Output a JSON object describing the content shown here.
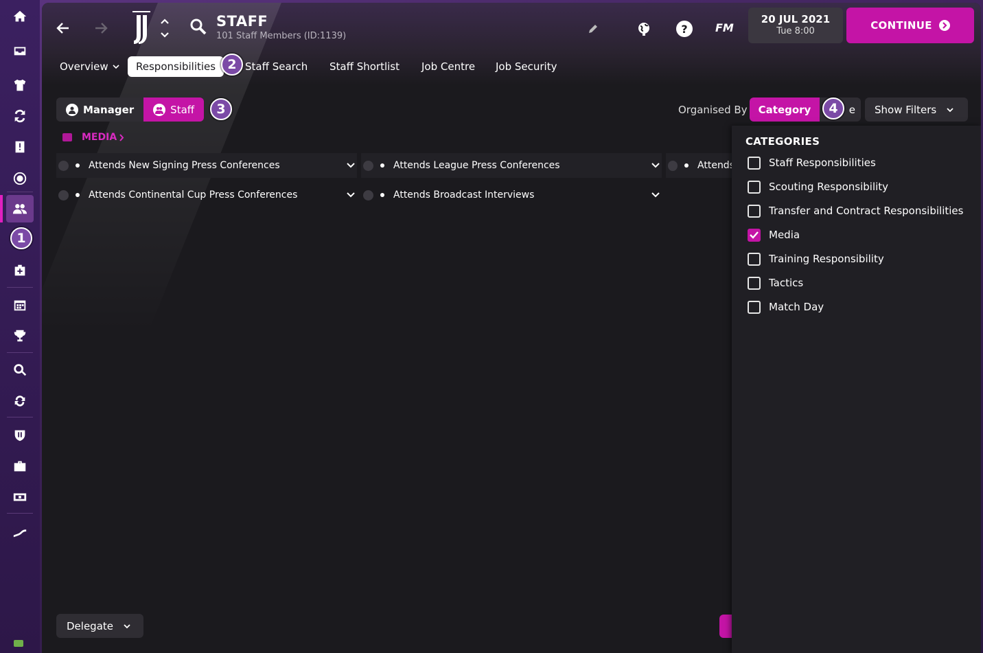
{
  "header": {
    "title": "STAFF",
    "subtitle": "101 Staff Members (ID:1139)",
    "fm_logo": "FM",
    "date": "20 JUL 2021",
    "day_time": "Tue 8:00",
    "continue_label": "CONTINUE"
  },
  "tabs": {
    "overview": "Overview",
    "responsibilities": "Responsibilities",
    "staff_search": "Staff Search",
    "staff_shortlist": "Staff Shortlist",
    "job_centre": "Job Centre",
    "job_security": "Job Security"
  },
  "badges": {
    "b1": "1",
    "b2": "2",
    "b3": "3",
    "b4": "4"
  },
  "toggle": {
    "manager": "Manager",
    "staff": "Staff"
  },
  "organise": {
    "label": "Organised By",
    "category": "Category",
    "role_partial": "e",
    "show_filters": "Show Filters"
  },
  "section": {
    "media_label": "MEDIA"
  },
  "responsibilities": [
    "Attends New Signing Press Conferences",
    "Attends League Press Conferences",
    "Attends",
    "Attends Continental Cup Press Conferences",
    "Attends Broadcast Interviews"
  ],
  "categories_panel": {
    "title": "CATEGORIES",
    "items": [
      {
        "label": "Staff Responsibilities",
        "checked": false
      },
      {
        "label": "Scouting Responsibility",
        "checked": false
      },
      {
        "label": "Transfer and Contract Responsibilities",
        "checked": false
      },
      {
        "label": "Media",
        "checked": true
      },
      {
        "label": "Training Responsibility",
        "checked": false
      },
      {
        "label": "Tactics",
        "checked": false
      },
      {
        "label": "Match Day",
        "checked": false
      }
    ]
  },
  "footer": {
    "delegate": "Delegate"
  },
  "colors": {
    "accent": "#c414a6",
    "sidebar": "#3b2060",
    "panel": "#1b1a1e"
  }
}
